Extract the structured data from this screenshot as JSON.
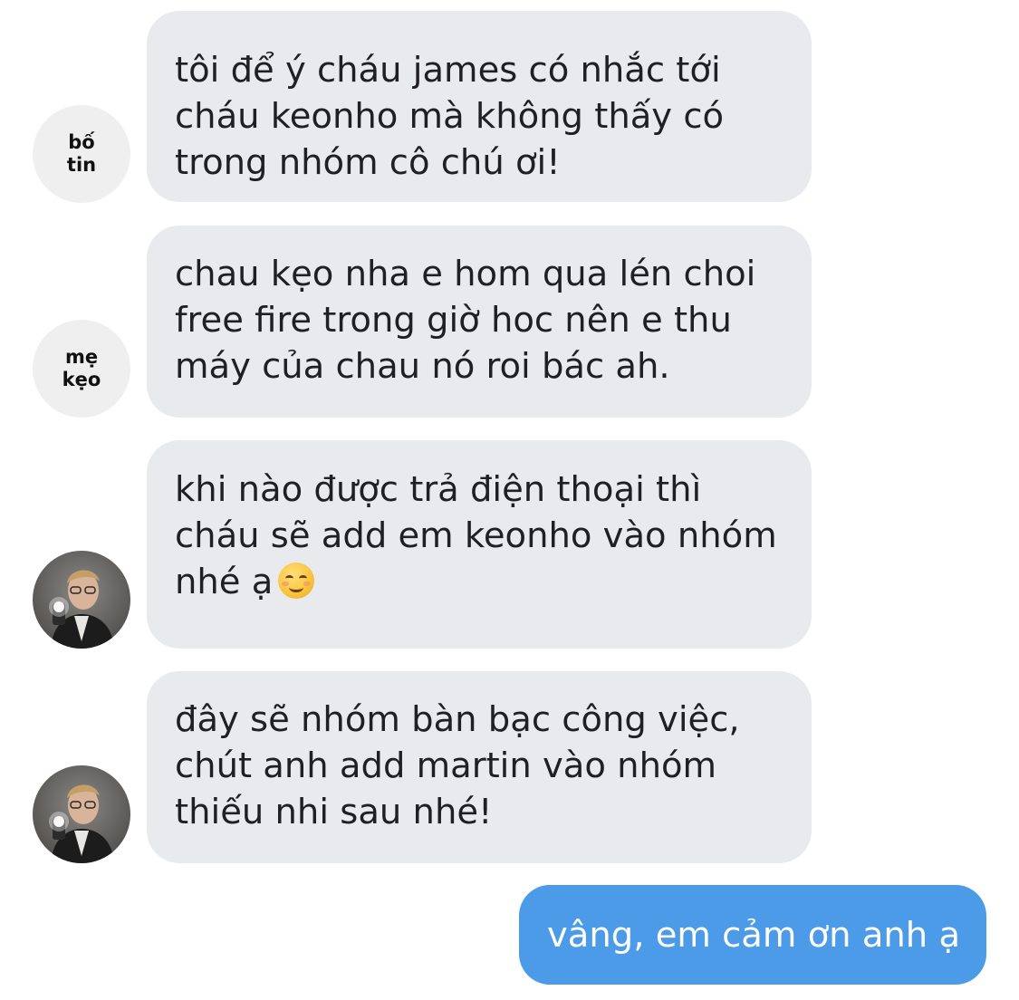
{
  "conversation": {
    "messages": [
      {
        "sender_label": "bố\ntin",
        "text": "tôi để ý cháu james có nhắc tới\ncháu keonho mà không thấy có\ntrong nhóm cô chú ơi!"
      },
      {
        "sender_label": "mẹ\nkẹo",
        "text": "chau kẹo nha e hom qua lén choi\nfree fire trong giờ hoc nên e thu\nmáy của chau nó roi bác ah."
      },
      {
        "sender_avatar": "profile-photo",
        "text": "khi nào được trả điện thoại thì\ncháu sẽ add em keonho vào nhóm\nnhé ạ",
        "emoji": "smiling-face-icon"
      },
      {
        "sender_avatar": "profile-photo",
        "text": "đây sẽ nhóm bàn bạc công việc,\nchút anh add martin vào nhóm\nthiếu nhi sau nhé!"
      }
    ],
    "outgoing": {
      "text": "vâng, em cảm ơn anh ạ"
    }
  },
  "colors": {
    "incoming_bubble": "#e9eaee",
    "outgoing_bubble": "#4b9be8",
    "incoming_text": "#1f1f24",
    "outgoing_text": "#ffffff",
    "avatar_placeholder": "#efeff0"
  }
}
